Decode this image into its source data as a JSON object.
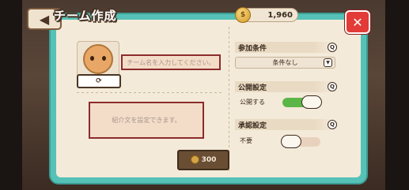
{
  "header": {
    "title": "チーム作成",
    "back_glyph": "◀",
    "coins": "1,960",
    "coin_glyph": "$",
    "close_glyph": "✕"
  },
  "team": {
    "refresh_glyph": "⟳",
    "name_placeholder": "チーム名を入力してください。",
    "description_placeholder": "紹介文を設定できます。",
    "create_cost": "300",
    "create_label": ""
  },
  "settings": {
    "join_condition": {
      "label": "参加条件",
      "value": "条件なし"
    },
    "public": {
      "label": "公開設定",
      "option": "公開する",
      "enabled": true
    },
    "approval": {
      "label": "承認設定",
      "option": "不要",
      "enabled": false
    },
    "info_glyph": "Q",
    "dropdown_glyph": "▼"
  },
  "colors": {
    "panel": "#56c2b7",
    "close": "#e23b38",
    "toggle_on": "#5bb648",
    "input_border": "#8c2b2b"
  }
}
